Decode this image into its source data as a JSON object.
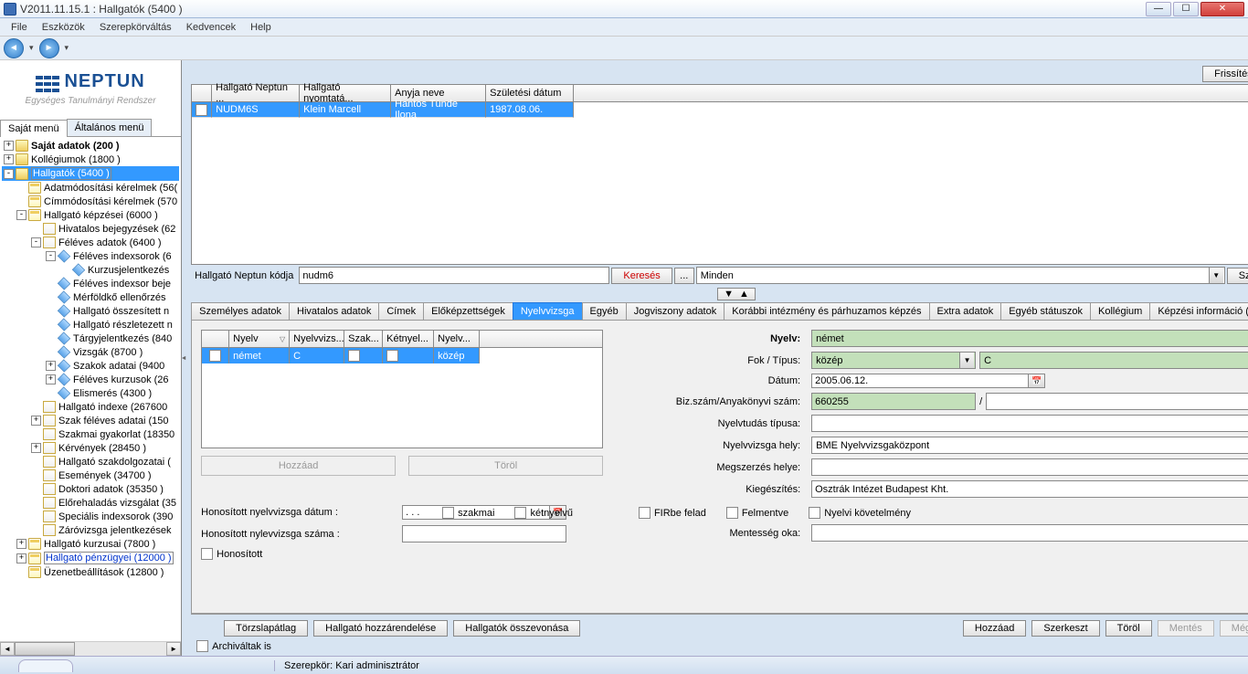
{
  "window": {
    "title": "V2011.11.15.1 : Hallgatók (5400  )"
  },
  "menubar": [
    "File",
    "Eszközök",
    "Szerepkörváltás",
    "Kedvencek",
    "Help"
  ],
  "logo": {
    "main": "NEPTUN",
    "sub": "Egységes Tanulmányi Rendszer"
  },
  "treeTabs": {
    "active": "Saját menü",
    "other": "Általános menü"
  },
  "tree": {
    "n0": "Saját adatok (200  )",
    "n1": "Kollégiumok (1800  )",
    "n2": "Hallgatók (5400  )",
    "n3": "Adatmódosítási kérelmek (56(",
    "n4": "Címmódosítási kérelmek (570",
    "n5": "Hallgató képzései (6000  )",
    "n6": "Hivatalos bejegyzések (62",
    "n7": "Féléves adatok (6400  )",
    "n8": "Féléves indexsorok (6",
    "n9": "Kurzusjelentkezés",
    "n10": "Féléves indexsor beje",
    "n11": "Mérföldkő ellenőrzés",
    "n12": "Hallgató összesített n",
    "n13": "Hallgató részletezett n",
    "n14": "Tárgyjelentkezés (840",
    "n15": "Vizsgák (8700  )",
    "n16": "Szakok adatai (9400",
    "n17": "Féléves kurzusok (26",
    "n18": "Elismerés (4300  )",
    "n19": "Hallgató indexe (267600",
    "n20": "Szak féléves adatai (150",
    "n21": "Szakmai gyakorlat (18350",
    "n22": "Kérvények (28450  )",
    "n23": "Hallgató szakdolgozatai (",
    "n24": "Események (34700  )",
    "n25": "Doktori adatok (35350  )",
    "n26": "Előrehaladás vizsgálat (35",
    "n27": "Speciális indexsorok (390",
    "n28": "Záróvizsga jelentkezések",
    "n29": "Hallgató kurzusai (7800  )",
    "n30": "Hallgató pénzügyei (12000  )",
    "n31": "Üzenetbeállítások (12800  )"
  },
  "topToolbar": {
    "refresh": "Frissítés"
  },
  "mainGrid": {
    "headers": [
      "",
      "Hallgató Neptun ...",
      "Hallgató nyomtatá...",
      "Anyja neve",
      "Születési dátum"
    ],
    "row": [
      "NUDM6S",
      "Klein Marcell",
      "Hantos Tünde Ilona",
      "1987.08.06."
    ]
  },
  "searchBar": {
    "label": "Hallgató Neptun kódja",
    "value": "nudm6",
    "searchBtn": "Keresés",
    "moreBtn": "...",
    "filterValue": "Minden",
    "filterBtn": "Szűrés"
  },
  "detailTabs": [
    "Személyes adatok",
    "Hivatalos adatok",
    "Címek",
    "Előképzettségek",
    "Nyelvvizsga",
    "Egyéb",
    "Jogviszony adatok",
    "Korábbi intézmény és párhuzamos képzés",
    "Extra adatok",
    "Egyéb státuszok",
    "Kollégium",
    "Képzési információ ("
  ],
  "miniGrid": {
    "headers": [
      "",
      "Nyelv",
      "Nyelvvizs...",
      "Szak...",
      "Kétnyel...",
      "Nyelv..."
    ],
    "row": {
      "nyelv": "német",
      "tipus": "C",
      "szak": "☐",
      "ketnyel": "☐",
      "fok": "közép"
    }
  },
  "leftButtons": {
    "add": "Hozzáad",
    "del": "Töröl"
  },
  "honositas": {
    "dateLbl": "Honosított nyelvvizsga dátum :",
    "dateVal": ". . .",
    "numLbl": "Honosított nylevvizsga száma :",
    "chk": "Honosított"
  },
  "props": {
    "nyelvLbl": "Nyelv:",
    "nyelvVal": "német",
    "fokLbl": "Fok / Típus:",
    "fokVal": "közép",
    "tipusVal": "C",
    "datumLbl": "Dátum:",
    "datumVal": "2005.06.12.",
    "bizLbl": "Biz.szám/Anyakönyvi szám:",
    "bizVal": "660255",
    "bizSep": "/",
    "tudastLbl": "Nyelvtudás típusa:",
    "helyLbl": "Nyelvvizsga hely:",
    "helyVal": "BME Nyelvvizsgaközpont",
    "megszLbl": "Megszerzés helye:",
    "kiegLbl": "Kiegészítés:",
    "kiegVal": "Osztrák Intézet Budapest Kht.",
    "mentLbl": "Mentesség oka:"
  },
  "checks": {
    "szakmai": "szakmai",
    "ketnyelvu": "kétnyelvű",
    "fir": "FIRbe felad",
    "felmentve": "Felmentve",
    "nyelvikov": "Nyelvi követelmény"
  },
  "bottomBar": {
    "torzs": "Törzslapátlag",
    "hozzarend": "Hallgató hozzárendelése",
    "osszevon": "Hallgatók összevonása",
    "archivalt": "Archiváltak is",
    "hozzaad": "Hozzáad",
    "szerkeszt": "Szerkeszt",
    "torol": "Töröl",
    "mentes": "Mentés",
    "megsem": "Mégsem"
  },
  "status": {
    "role": "Szerepkör: Kari adminisztrátor"
  }
}
